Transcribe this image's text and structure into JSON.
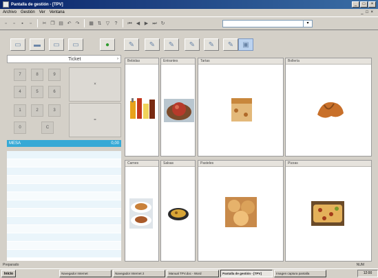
{
  "window": {
    "title": "Pantalla de gestión - [TPV]",
    "controls": [
      "_",
      "□",
      "×"
    ]
  },
  "menu": {
    "items": [
      "Archivo",
      "Gestión",
      "Ver",
      "Ventana"
    ],
    "mdi_controls": "_ □ ×"
  },
  "toolbar": {
    "icons": [
      "new-icon",
      "open-icon",
      "save-icon",
      "print-icon",
      "cut-icon",
      "copy-icon",
      "paste-icon",
      "undo-icon",
      "redo-icon",
      "grid-icon",
      "sort-icon",
      "filter-icon",
      "help-icon",
      "nav-first-icon",
      "nav-prev-icon",
      "nav-next-icon",
      "nav-last-icon",
      "refresh-icon"
    ],
    "combo_value": ""
  },
  "function_buttons": [
    {
      "name": "monitor-button",
      "glyph": "▭"
    },
    {
      "name": "printer-button",
      "glyph": "▬"
    },
    {
      "name": "keyboard-button",
      "glyph": "▭"
    },
    {
      "name": "display-button",
      "glyph": "▭"
    },
    {
      "name": "cash-button",
      "glyph": "●"
    },
    {
      "name": "tool1-button",
      "glyph": "✎"
    },
    {
      "name": "tool2-button",
      "glyph": "✎"
    },
    {
      "name": "tool3-button",
      "glyph": "✎"
    },
    {
      "name": "tool4-button",
      "glyph": "✎"
    },
    {
      "name": "tool5-button",
      "glyph": "✎"
    },
    {
      "name": "tool6-button",
      "glyph": "✎"
    },
    {
      "name": "tool7-button",
      "glyph": "▣"
    }
  ],
  "ticket": {
    "label": "Ticket",
    "arrow": "›"
  },
  "keypad": {
    "keys": [
      "7",
      "8",
      "9",
      "4",
      "5",
      "6",
      "1",
      "2",
      "3",
      "0",
      "C"
    ],
    "big_keys": [
      "×",
      "="
    ]
  },
  "order": {
    "header": "MESA",
    "total": "0,00",
    "rows": 13
  },
  "categories": [
    {
      "name": "Bebidas",
      "icon": "drinks-icon"
    },
    {
      "name": "Entrantes",
      "icon": "apple-tart-icon"
    },
    {
      "name": "Tartas",
      "icon": "cake-icon"
    },
    {
      "name": "Bollería",
      "icon": "croissant-icon"
    },
    {
      "name": "Carnes",
      "icon": "plated-dish-icon"
    },
    {
      "name": "Salsas",
      "icon": "soup-bowl-icon"
    },
    {
      "name": "Pasteles",
      "icon": "pastry-icon"
    },
    {
      "name": "Pizzas",
      "icon": "pizza-icon"
    }
  ],
  "status": {
    "left": "Preparado",
    "right": "NUM"
  },
  "taskbar": {
    "start": "Inicio",
    "tasks": [
      "Navegador Internet",
      "Navegador Internet 2",
      "Manual TPV.doc - Word",
      "Pantalla de gestión - [TPV]",
      "Imagen captura pantalla"
    ],
    "active_index": 3,
    "tray": "12:00"
  },
  "colors": {
    "title_bar": "#0a246a",
    "order_header": "#36a9d6",
    "list_odd": "#eaf5fb",
    "money_icon": "#2f9b2f"
  }
}
